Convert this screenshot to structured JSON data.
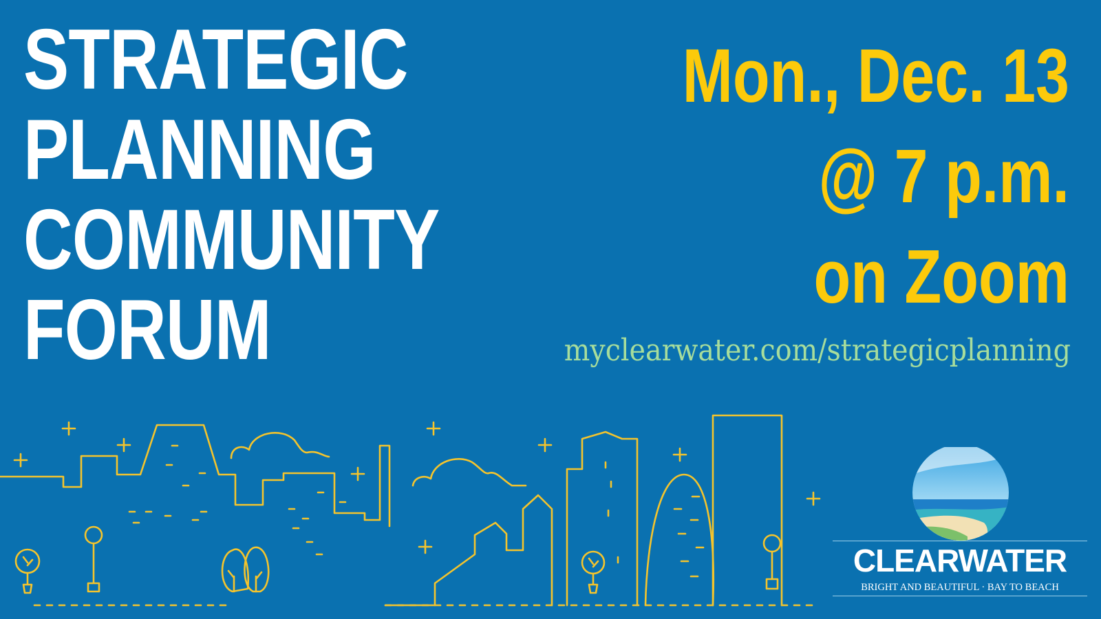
{
  "title": {
    "lines": [
      "STRATEGIC",
      "PLANNING",
      "COMMUNITY",
      "FORUM"
    ]
  },
  "event": {
    "date": "Mon., Dec. 13",
    "time": "@ 7 p.m.",
    "venue": "on Zoom"
  },
  "url": "myclearwater.com/strategicplanning",
  "logo": {
    "wordmark": "CLEARWATER",
    "tagline": "BRIGHT AND BEAUTIFUL · BAY TO BEACH",
    "icon": "beach-globe-icon"
  },
  "illustration": {
    "icon": "city-skyline-illustration"
  },
  "colors": {
    "background": "#0a71b0",
    "title": "#ffffff",
    "accent": "#fcca0b",
    "url": "#a7dd9c"
  }
}
